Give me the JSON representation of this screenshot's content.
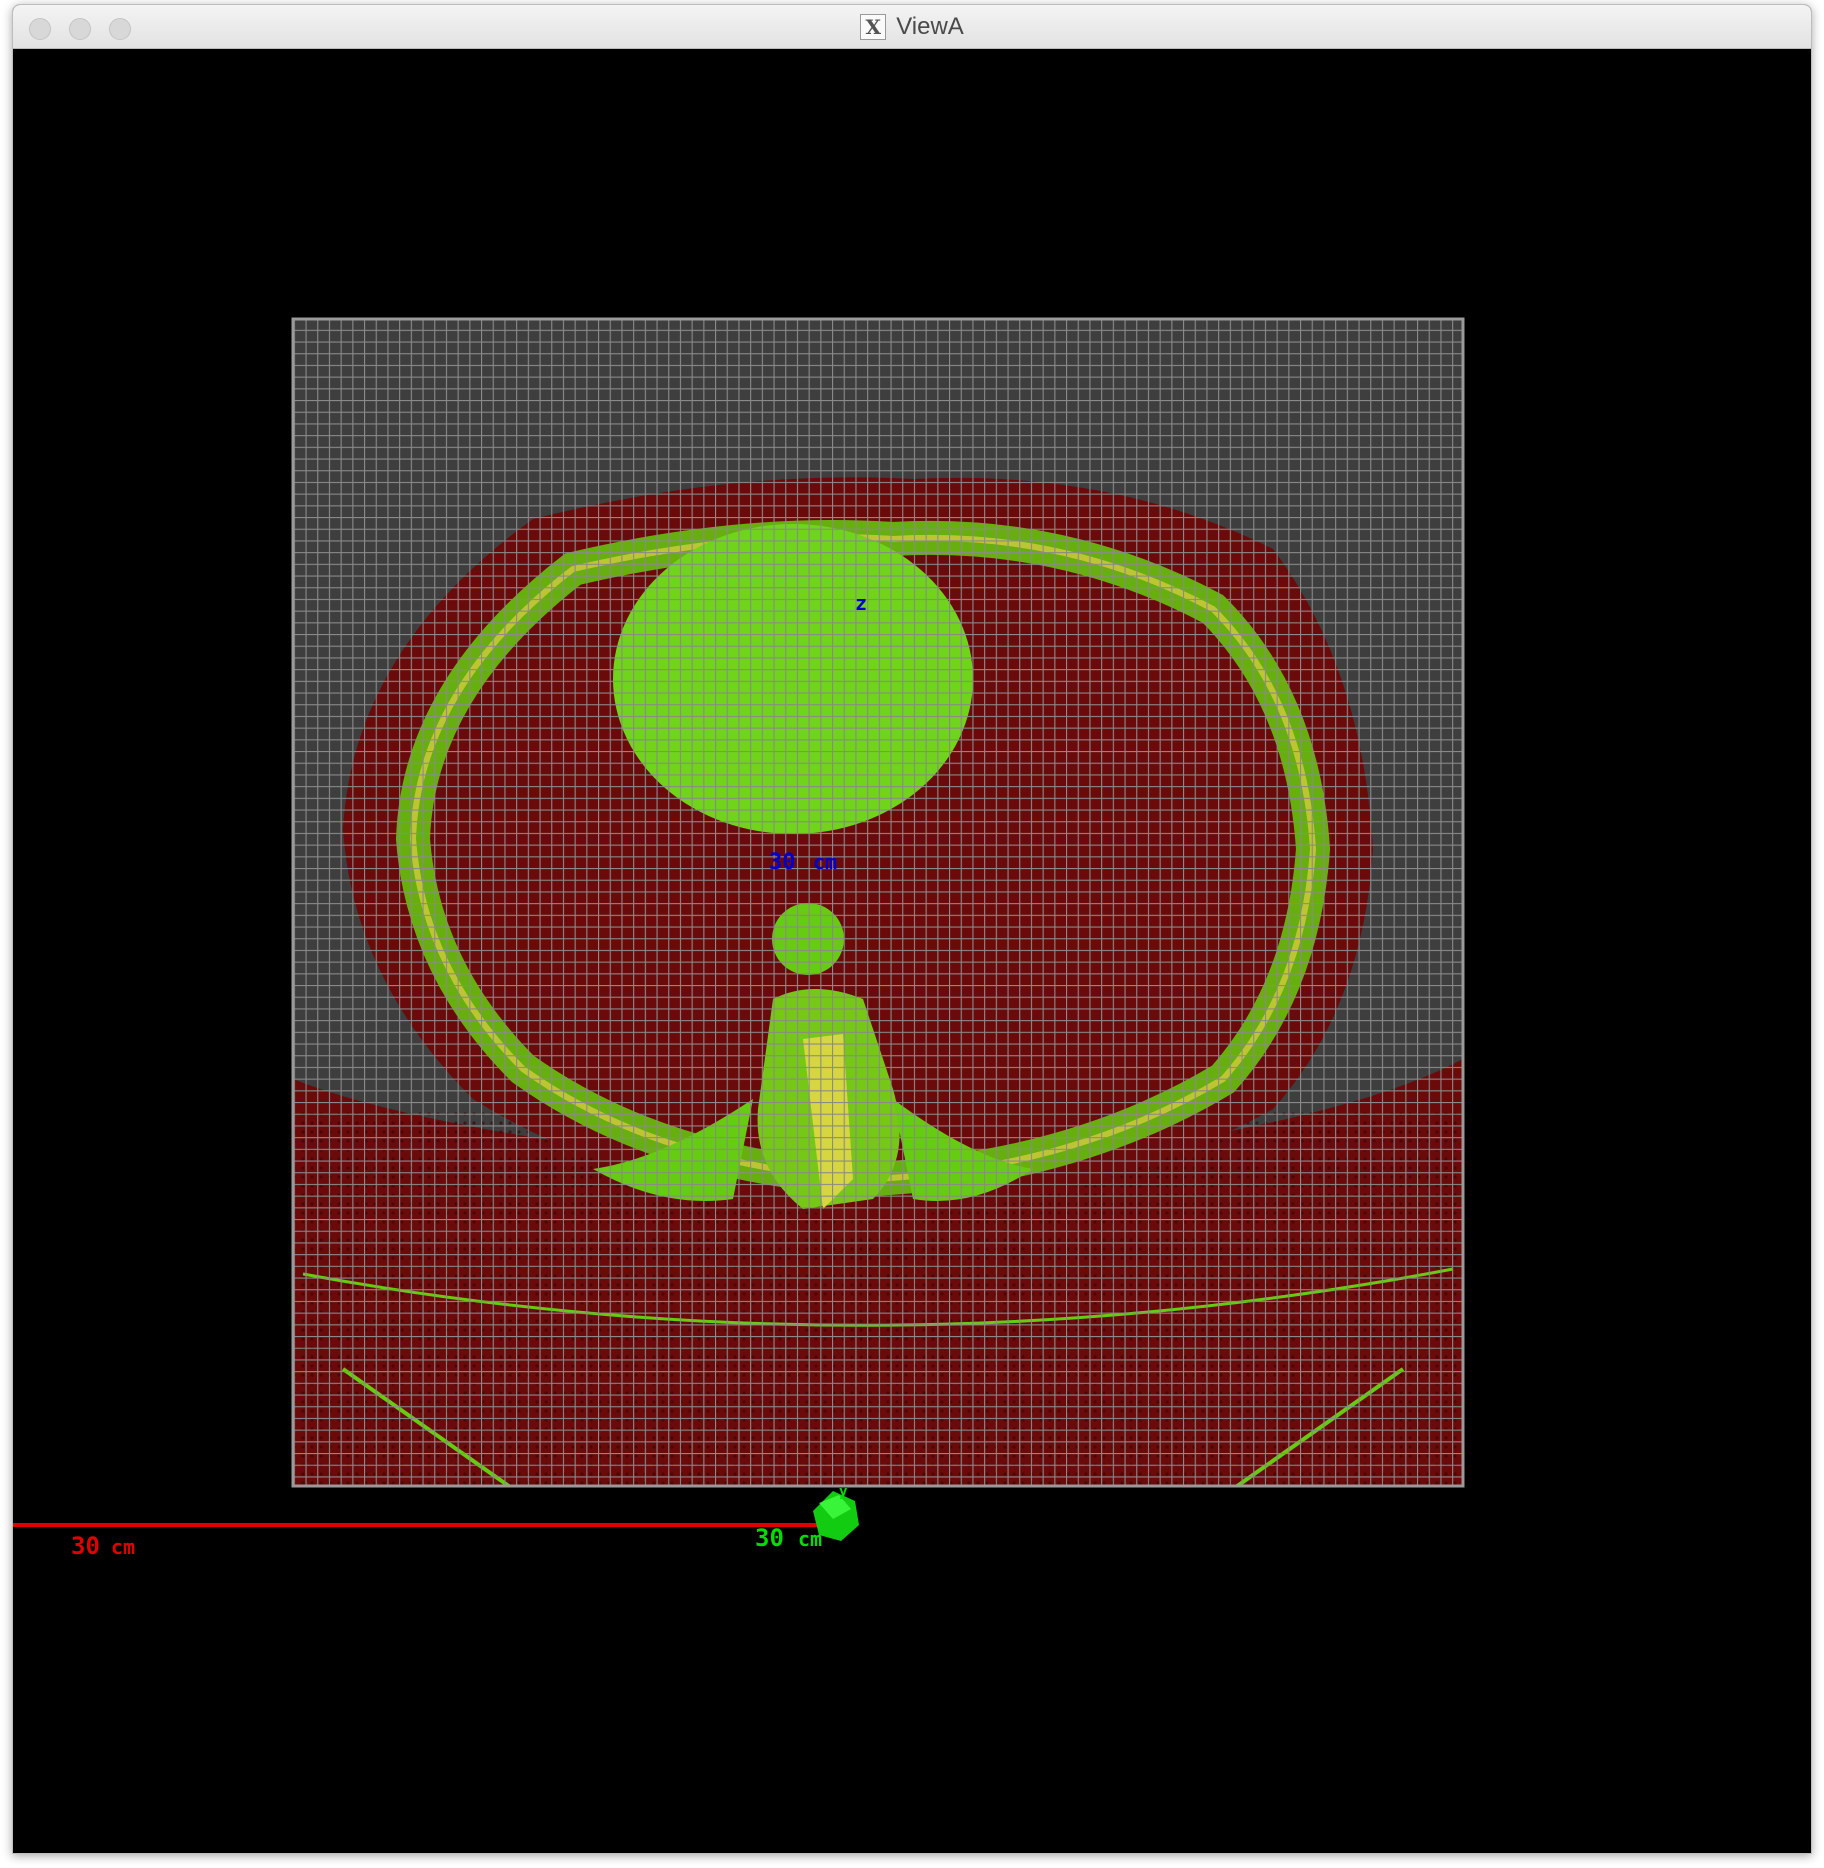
{
  "window": {
    "title": "ViewA",
    "app_icon": "x11-icon"
  },
  "axes": {
    "z": {
      "label": "z",
      "scale_value": "30",
      "scale_unit": "cm",
      "color": "#0000cc"
    },
    "x_red": {
      "scale_value": "30",
      "scale_unit": "cm",
      "color": "#e00000"
    },
    "y_green": {
      "label": "y",
      "scale_value": "30",
      "scale_unit": "cm",
      "color": "#00dd00"
    }
  },
  "colors": {
    "background": "#000000",
    "grid": "#808080",
    "tissue": "#6b0a0a",
    "organ": "#66cc11",
    "bone": "#c8c83a"
  }
}
